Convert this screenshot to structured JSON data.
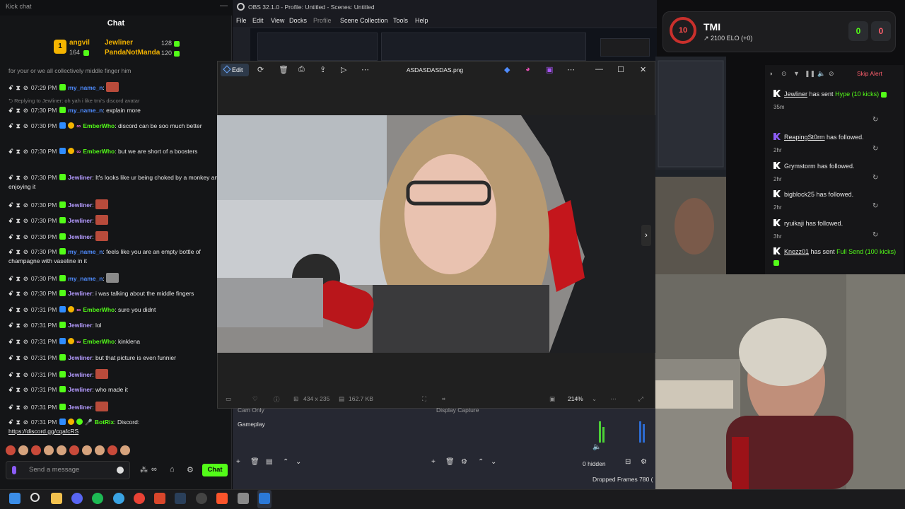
{
  "chat": {
    "window_title": "Kick chat",
    "header": "Chat",
    "leaderboard": [
      {
        "name": "angvil",
        "count": "128"
      },
      {
        "name": "Jewliner",
        "count": "128"
      },
      {
        "name": "PandaNotManda",
        "count": "120"
      }
    ],
    "leader_badge_count": "164",
    "rank_badge": "1",
    "pinned_cut": "for your or we all collectively middle finger him",
    "reply_hint": "Replying to Jewliner: oh yah i like tmi's discord avatar",
    "messages": [
      {
        "time": "07:29 PM",
        "user": "my_name_n",
        "text": ""
      },
      {
        "time": "07:30 PM",
        "user": "my_name_n",
        "text": "explain more"
      },
      {
        "time": "07:30 PM",
        "user": "EmberWho",
        "text": "discord can be soo much better"
      },
      {
        "time": "07:30 PM",
        "user": "EmberWho",
        "text": "but we are short of a boosters"
      },
      {
        "time": "07:30 PM",
        "user": "Jewliner",
        "text": "It's looks like ur being choked by a monkey and ur enjoying it"
      },
      {
        "time": "07:30 PM",
        "user": "Jewliner",
        "text": ""
      },
      {
        "time": "07:30 PM",
        "user": "Jewliner",
        "text": ""
      },
      {
        "time": "07:30 PM",
        "user": "Jewliner",
        "text": ""
      },
      {
        "time": "07:30 PM",
        "user": "my_name_n",
        "text": "feels like you are an empty bottle of champagne with vaseline in it"
      },
      {
        "time": "07:30 PM",
        "user": "my_name_n",
        "text": ""
      },
      {
        "time": "07:30 PM",
        "user": "Jewliner",
        "text": "i was talking about the middle fingers"
      },
      {
        "time": "07:31 PM",
        "user": "EmberWho",
        "text": "sure you didnt"
      },
      {
        "time": "07:31 PM",
        "user": "Jewliner",
        "text": "lol"
      },
      {
        "time": "07:31 PM",
        "user": "EmberWho",
        "text": "kinklena"
      },
      {
        "time": "07:31 PM",
        "user": "Jewliner",
        "text": "but that picture is even funnier"
      },
      {
        "time": "07:31 PM",
        "user": "Jewliner",
        "text": ""
      },
      {
        "time": "07:31 PM",
        "user": "Jewliner",
        "text": "who made it"
      },
      {
        "time": "07:31 PM",
        "user": "Jewliner",
        "text": ""
      },
      {
        "time": "07:31 PM",
        "user": "BotRix",
        "text": "Discord:"
      }
    ],
    "discord_link": "https://discord.gg/cqafcRS",
    "input_placeholder": "Send a message",
    "send_label": "Chat"
  },
  "obs": {
    "window_title": "OBS 32.1.0 - Profile: Untitled - Scenes: Untitled",
    "menu": [
      "File",
      "Edit",
      "View",
      "Docks",
      "Profile",
      "Scene Collection",
      "Tools",
      "Help"
    ],
    "scene_cut": "Cam Only",
    "scene_item": "Gameplay",
    "source_cut": "Display Capture",
    "hidden_count": "0 hidden",
    "dropped_frames": "Dropped Frames 780 ("
  },
  "viewer": {
    "edit_label": "Edit",
    "file_name": "ASDASDASDAS.png",
    "dimensions": "434 x 235",
    "file_size": "162.7 KB",
    "zoom": "214%"
  },
  "tmi": {
    "rank": "10",
    "title": "TMI",
    "elo": "2100 ELO (+0)",
    "score_left": "0",
    "score_right": "0"
  },
  "alerts": {
    "skip_label": "Skip Alert",
    "items": [
      {
        "user": "Jewliner",
        "action": "has sent",
        "highlight": "Hype (10 kicks)",
        "time": "35m"
      },
      {
        "user": "ReapingSt0rm",
        "action": "has followed.",
        "highlight": "",
        "time": "2hr"
      },
      {
        "user": "Grymstorm",
        "action": "has followed.",
        "highlight": "",
        "time": "2hr"
      },
      {
        "user": "bigblock25",
        "action": "has followed.",
        "highlight": "",
        "time": "2hr"
      },
      {
        "user": "ryuikaji",
        "action": "has followed.",
        "highlight": "",
        "time": "3hr"
      },
      {
        "user": "Knezz01",
        "action": "has sent",
        "highlight": "Full Send (100 kicks)",
        "time": ""
      }
    ]
  },
  "colors": {
    "kick_green": "#53fc18",
    "alert_red": "#ff5f6d",
    "accent_blue": "#4f8cff"
  }
}
